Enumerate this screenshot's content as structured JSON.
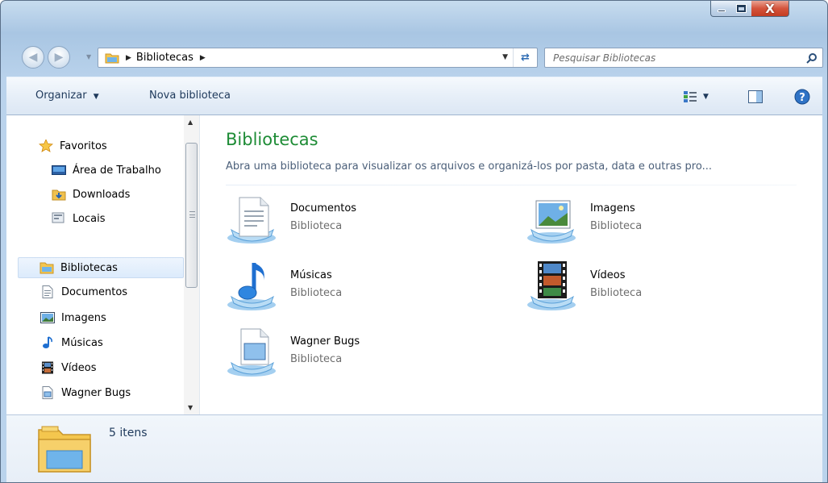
{
  "window": {
    "minimize_label": "minimize",
    "maximize_label": "maximize",
    "close_label": "X"
  },
  "address": {
    "crumbs": [
      "Bibliotecas"
    ],
    "search_placeholder": "Pesquisar Bibliotecas"
  },
  "toolbar": {
    "organize_label": "Organizar",
    "new_library_label": "Nova biblioteca"
  },
  "nav_pane": {
    "favorites_label": "Favoritos",
    "favorites": [
      {
        "label": "Área de Trabalho",
        "icon": "desktop-icon"
      },
      {
        "label": "Downloads",
        "icon": "downloads-icon"
      },
      {
        "label": "Locais",
        "icon": "recent-places-icon"
      }
    ],
    "libraries_label": "Bibliotecas",
    "libraries": [
      {
        "label": "Documentos",
        "icon": "documents-icon"
      },
      {
        "label": "Imagens",
        "icon": "pictures-icon"
      },
      {
        "label": "Músicas",
        "icon": "music-icon"
      },
      {
        "label": "Vídeos",
        "icon": "videos-icon"
      },
      {
        "label": "Wagner Bugs",
        "icon": "custom-library-icon"
      }
    ]
  },
  "main": {
    "title": "Bibliotecas",
    "description": "Abra uma biblioteca para visualizar os arquivos e organizá-los por pasta, data e outras pro...",
    "libraries": [
      {
        "name": "Documentos",
        "type": "Biblioteca",
        "icon": "documents-library-icon"
      },
      {
        "name": "Imagens",
        "type": "Biblioteca",
        "icon": "pictures-library-icon"
      },
      {
        "name": "Músicas",
        "type": "Biblioteca",
        "icon": "music-library-icon"
      },
      {
        "name": "Vídeos",
        "type": "Biblioteca",
        "icon": "videos-library-icon"
      },
      {
        "name": "Wagner Bugs",
        "type": "Biblioteca",
        "icon": "custom-library-icon"
      }
    ]
  },
  "details": {
    "item_count": "5 itens"
  },
  "colors": {
    "title_green": "#1e8c36",
    "chrome_blue": "#bad3ec",
    "close_red": "#d5543c"
  }
}
